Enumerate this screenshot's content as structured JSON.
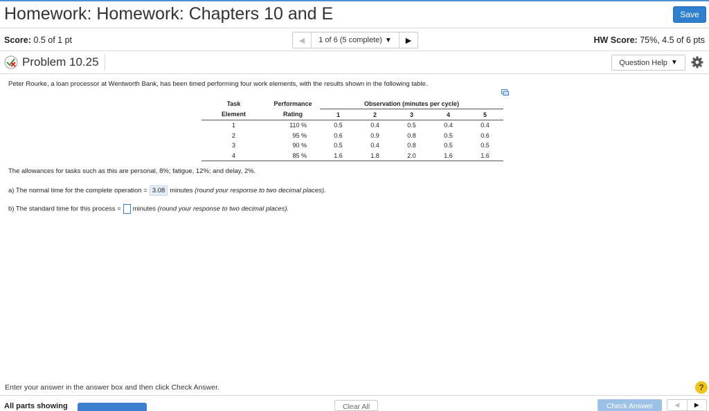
{
  "header": {
    "title": "Homework: Homework: Chapters 10 and E",
    "save_label": "Save"
  },
  "status": {
    "score_label": "Score:",
    "score_value": "0.5 of 1 pt",
    "nav_count": "1 of 6 (5 complete)",
    "hw_score_label": "HW Score:",
    "hw_score_value": "75%, 4.5 of 6 pts"
  },
  "problem": {
    "title": "Problem 10.25",
    "help_label": "Question Help"
  },
  "content": {
    "intro": "Peter Rourke, a loan processor at Wentworth Bank, has been timed performing four work elements, with the results shown in the following table.",
    "table": {
      "col1_top": "Task",
      "col1_bottom": "Element",
      "col2_top": "Performance",
      "col2_bottom": "Rating",
      "obs_header": "Observation (minutes per cycle)",
      "obs_cols": [
        "1",
        "2",
        "3",
        "4",
        "5"
      ],
      "rows": [
        {
          "task": "1",
          "rating": "110 %",
          "obs": [
            "0.5",
            "0.4",
            "0.5",
            "0.4",
            "0.4"
          ]
        },
        {
          "task": "2",
          "rating": "95 %",
          "obs": [
            "0.6",
            "0.9",
            "0.8",
            "0.5",
            "0.6"
          ]
        },
        {
          "task": "3",
          "rating": "90 %",
          "obs": [
            "0.5",
            "0.4",
            "0.8",
            "0.5",
            "0.5"
          ]
        },
        {
          "task": "4",
          "rating": "85 %",
          "obs": [
            "1.6",
            "1.8",
            "2.0",
            "1.6",
            "1.6"
          ]
        }
      ]
    },
    "allowances": "The allowances for tasks such as this are personal, 8%; fatigue, 12%; and delay, 2%.",
    "part_a_prefix": "a) The normal time for the complete operation =",
    "part_a_answer": "3.08",
    "part_a_suffix": "minutes",
    "part_a_note": "(round your response to two decimal places).",
    "part_b_prefix": "b) The standard time for this process =",
    "part_b_suffix": "minutes",
    "part_b_note": "(round your response to two decimal places)."
  },
  "footer": {
    "instruction": "Enter your answer in the answer box and then click Check Answer.",
    "all_parts": "All parts showing",
    "clear_all": "Clear All",
    "check_answer": "Check Answer",
    "help_glyph": "?"
  },
  "colors": {
    "accent": "#2f7fd0",
    "topbar": "#4a8fd4",
    "help_icon": "#f0c419",
    "answer_highlight": "#e5eef8"
  }
}
